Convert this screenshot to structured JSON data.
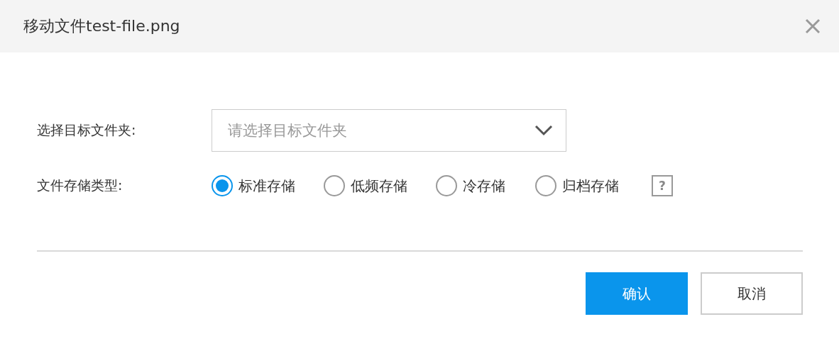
{
  "dialog": {
    "title": "移动文件test-file.png"
  },
  "target_folder": {
    "label": "选择目标文件夹:",
    "placeholder": "请选择目标文件夹"
  },
  "storage_type": {
    "label": "文件存储类型:",
    "options": [
      {
        "label": "标准存储",
        "selected": true
      },
      {
        "label": "低频存储",
        "selected": false
      },
      {
        "label": "冷存储",
        "selected": false
      },
      {
        "label": "归档存储",
        "selected": false
      }
    ],
    "help": "?"
  },
  "buttons": [
    {
      "label": "确认",
      "kind": "primary"
    },
    {
      "label": "取消",
      "kind": "secondary"
    }
  ]
}
